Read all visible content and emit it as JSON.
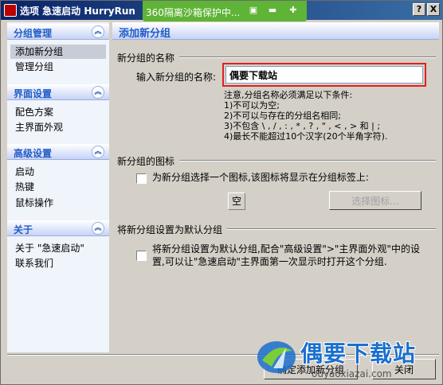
{
  "window": {
    "title": "选项 急速启动 HurryRun",
    "help_label": "?",
    "close_label": "X"
  },
  "notification": {
    "text": "360隔离沙箱保护中..."
  },
  "sidebar": {
    "sections": [
      {
        "title": "分组管理",
        "items": [
          {
            "label": "添加新分组",
            "active": true
          },
          {
            "label": "管理分组",
            "active": false
          }
        ]
      },
      {
        "title": "界面设置",
        "items": [
          {
            "label": "配色方案",
            "active": false
          },
          {
            "label": "主界面外观",
            "active": false
          }
        ]
      },
      {
        "title": "高级设置",
        "items": [
          {
            "label": "启动",
            "active": false
          },
          {
            "label": "热键",
            "active": false
          },
          {
            "label": "鼠标操作",
            "active": false
          }
        ]
      },
      {
        "title": "关于",
        "items": [
          {
            "label": "关于 \"急速启动\"",
            "active": false
          },
          {
            "label": "联系我们",
            "active": false
          }
        ]
      }
    ]
  },
  "main": {
    "title": "添加新分组",
    "name_group": {
      "label": "新分组的名称",
      "field_label": "输入新分组的名称:",
      "field_value": "偶要下载站",
      "notes": [
        "注意,分组名称必须满足以下条件:",
        "1)不可以为空;",
        "2)不可以与存在的分组名相同;",
        "3)不包含 \\ , / , : , * , ? , \" , < , > 和 | ;",
        "4)最长不能超过10个汉字(20个半角字符)."
      ]
    },
    "icon_group": {
      "label": "新分组的图标",
      "checkbox_label": "为新分组选择一个图标,该图标将显示在分组标签上:",
      "preview_text": "空",
      "choose_button": "选择图标..."
    },
    "default_group": {
      "label": "将新分组设置为默认分组",
      "checkbox_line1": "将新分组设置为默认分组,配合\"高级设置\">\"主界面外观\"中的设",
      "checkbox_line2": "置,可以让\"急速启动\"主界面第一次显示时打开这个分组."
    },
    "buttons": {
      "add": "确定添加新分组",
      "close": "关闭"
    }
  },
  "watermark": {
    "title": "偶要下载站",
    "url": "ouyaoxiazai.com"
  },
  "colors": {
    "accent": "#215dc6",
    "titlebar": "#0a246a",
    "notify": "#5fb336",
    "highlight": "#e02020"
  }
}
